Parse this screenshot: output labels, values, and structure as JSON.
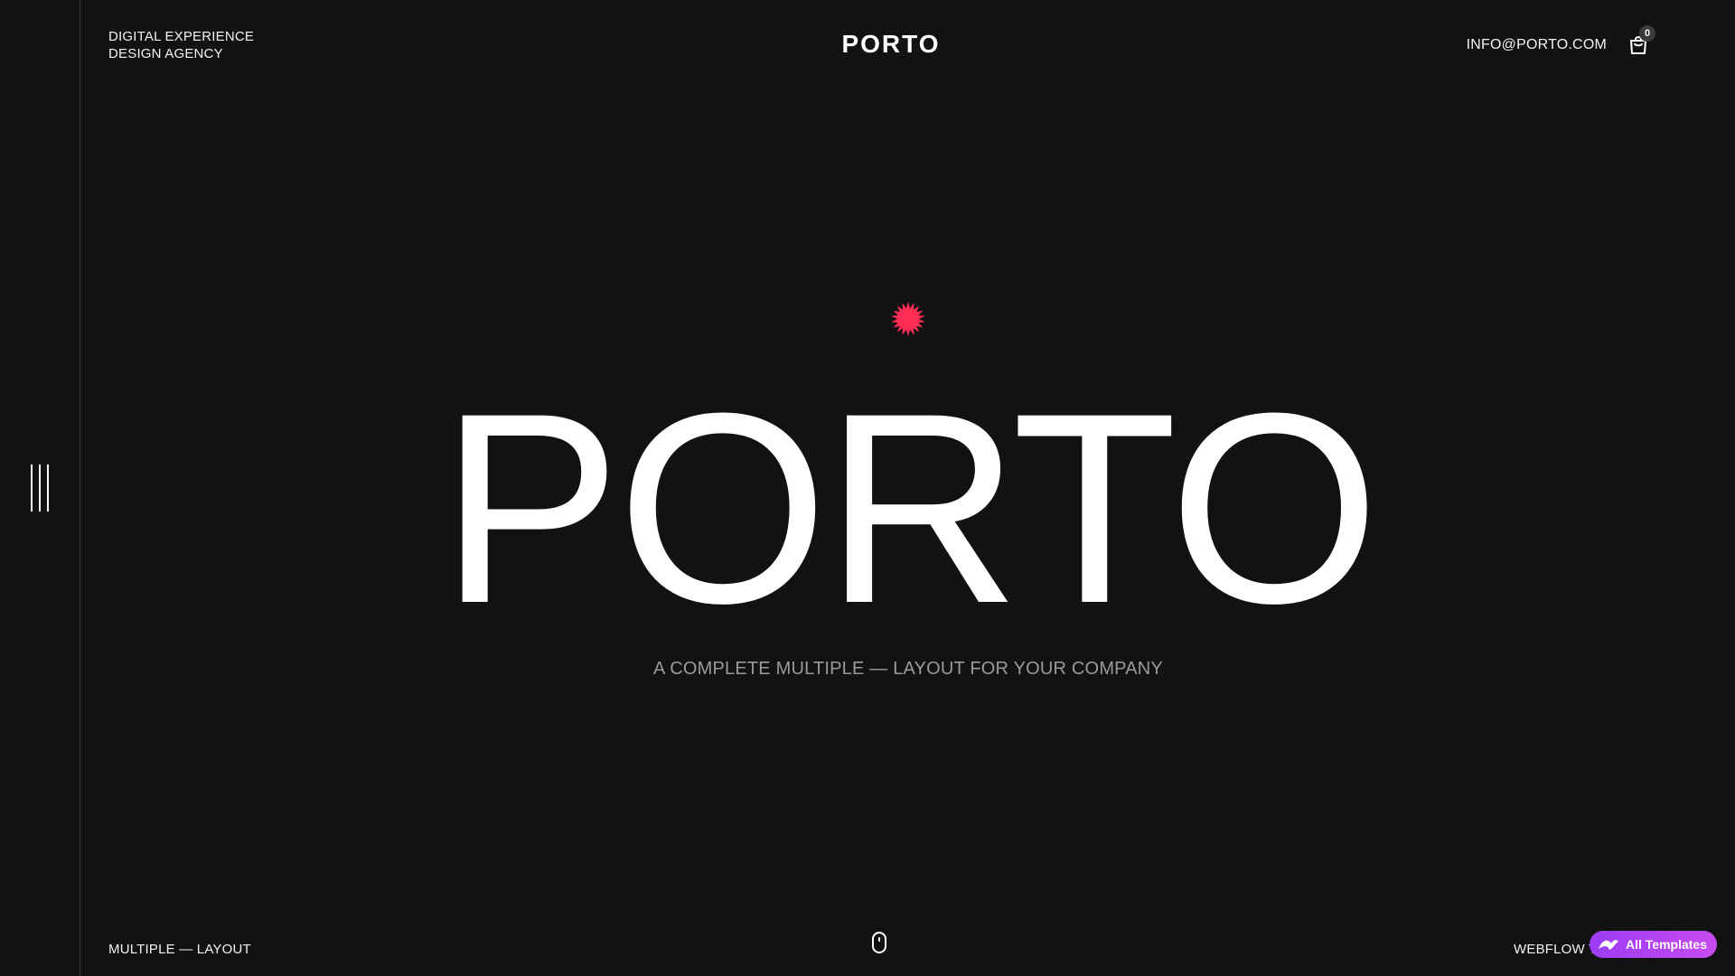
{
  "header": {
    "tagline_line1": "DIGITAL EXPERIENCE",
    "tagline_line2": "DESIGN AGENCY",
    "logo": "PORTO",
    "email": "INFO@PORTO.COM",
    "cart_count": "0"
  },
  "hero": {
    "title": "PORTO",
    "subtitle": "A COMPLETE MULTIPLE — LAYOUT FOR YOUR COMPANY",
    "accent_color": "#ff2d55"
  },
  "footer": {
    "left_label": "MULTIPLE — LAYOUT",
    "right_label": "WEBFLOW T",
    "badge_label": "All Templates",
    "badge_color": "#a53ff4"
  },
  "icons": {
    "menu": "menu-lines-icon",
    "cart": "shopping-bag-icon",
    "star": "starburst-icon",
    "scroll": "mouse-scroll-icon",
    "badge": "templates-logo-icon"
  }
}
